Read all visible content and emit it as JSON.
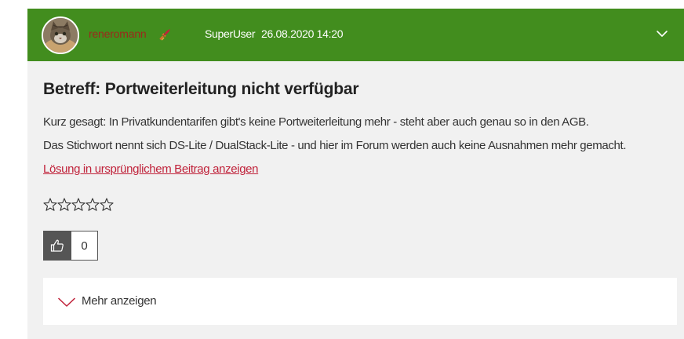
{
  "header": {
    "username": "reneromann",
    "role": "SuperUser",
    "timestamp": "26.08.2020 14:20",
    "avatar_icon": "cat-avatar",
    "rank_icon": "rocket-icon",
    "toggle_icon": "chevron-down-icon",
    "background_color": "#428d1e"
  },
  "post": {
    "subject": "Betreff: Portweiterleitung nicht verfügbar",
    "body_lines": [
      "Kurz gesagt: In Privatkundentarifen gibt's keine Portweiterleitung mehr - steht aber auch genau so in den AGB.",
      "Das Stichwort nennt sich DS-Lite / DualStack-Lite - und hier im Forum werden auch keine Ausnahmen mehr gemacht."
    ],
    "solution_link": "Lösung in ursprünglichem Beitrag anzeigen",
    "link_color": "#c0223a"
  },
  "rating": {
    "stars_filled": 0,
    "stars_total": 5,
    "icon": "star-outline-icon"
  },
  "kudos": {
    "icon": "thumbs-up-icon",
    "count": "0"
  },
  "show_more": {
    "label": "Mehr anzeigen",
    "icon": "chevron-down-icon",
    "icon_color": "#c0223a"
  }
}
